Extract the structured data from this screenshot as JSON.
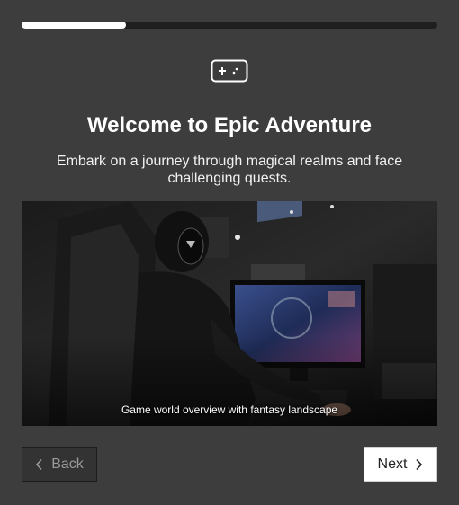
{
  "progress": {
    "value": 0.25
  },
  "header": {
    "icon": "gamepad-icon",
    "title": "Welcome to Epic Adventure",
    "subtitle": "Embark on a journey through magical realms and face challenging quests."
  },
  "hero": {
    "caption": "Game world overview with fantasy landscape"
  },
  "nav": {
    "back_label": "Back",
    "back_icon": "chevron-left-icon",
    "next_label": "Next",
    "next_icon": "chevron-right-icon"
  },
  "colors": {
    "background": "#3d3d3d",
    "progress_track": "#1f1f1f",
    "progress_fill": "#ffffff",
    "primary_button": "#ffffff",
    "disabled_button": "#333333"
  }
}
